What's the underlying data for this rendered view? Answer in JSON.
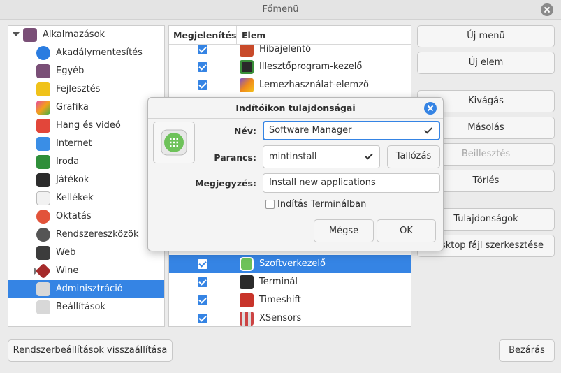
{
  "window": {
    "title": "Főmenü"
  },
  "categories": [
    {
      "label": "Alkalmazások"
    },
    {
      "label": "Akadálymentesítés"
    },
    {
      "label": "Egyéb"
    },
    {
      "label": "Fejlesztés"
    },
    {
      "label": "Grafika"
    },
    {
      "label": "Hang és videó"
    },
    {
      "label": "Internet"
    },
    {
      "label": "Iroda"
    },
    {
      "label": "Játékok"
    },
    {
      "label": "Kellékek"
    },
    {
      "label": "Oktatás"
    },
    {
      "label": "Rendszereszközök"
    },
    {
      "label": "Web"
    },
    {
      "label": "Wine"
    },
    {
      "label": "Adminisztráció"
    },
    {
      "label": "Beállítások"
    }
  ],
  "list": {
    "col_show": "Megjelenítés",
    "col_item": "Elem",
    "items": [
      {
        "label": "Hibajelentő"
      },
      {
        "label": "Illesztőprogram-kezelő"
      },
      {
        "label": "Lemezhasználat-elemző"
      },
      {
        "label": "Szoftverkezelő"
      },
      {
        "label": "Terminál"
      },
      {
        "label": "Timeshift"
      },
      {
        "label": "XSensors"
      }
    ]
  },
  "buttons": {
    "new_menu": "Új menü",
    "new_item": "Új elem",
    "cut": "Kivágás",
    "copy": "Másolás",
    "paste": "Beillesztés",
    "delete": "Törlés",
    "properties": "Tulajdonságok",
    "edit_desktop": "Desktop fájl szerkesztése",
    "reset": "Rendszerbeállítások visszaállítása",
    "close": "Bezárás"
  },
  "dialog": {
    "title": "Indítóikon tulajdonságai",
    "name_label": "Név:",
    "name_value": "Software Manager",
    "command_label": "Parancs:",
    "command_value": "mintinstall",
    "browse": "Tallózás",
    "comment_label": "Megjegyzés:",
    "comment_value": "Install new applications",
    "terminal_label": "Indítás Terminálban",
    "cancel": "Mégse",
    "ok": "OK"
  },
  "colors": {
    "accent": "#3584e4"
  }
}
